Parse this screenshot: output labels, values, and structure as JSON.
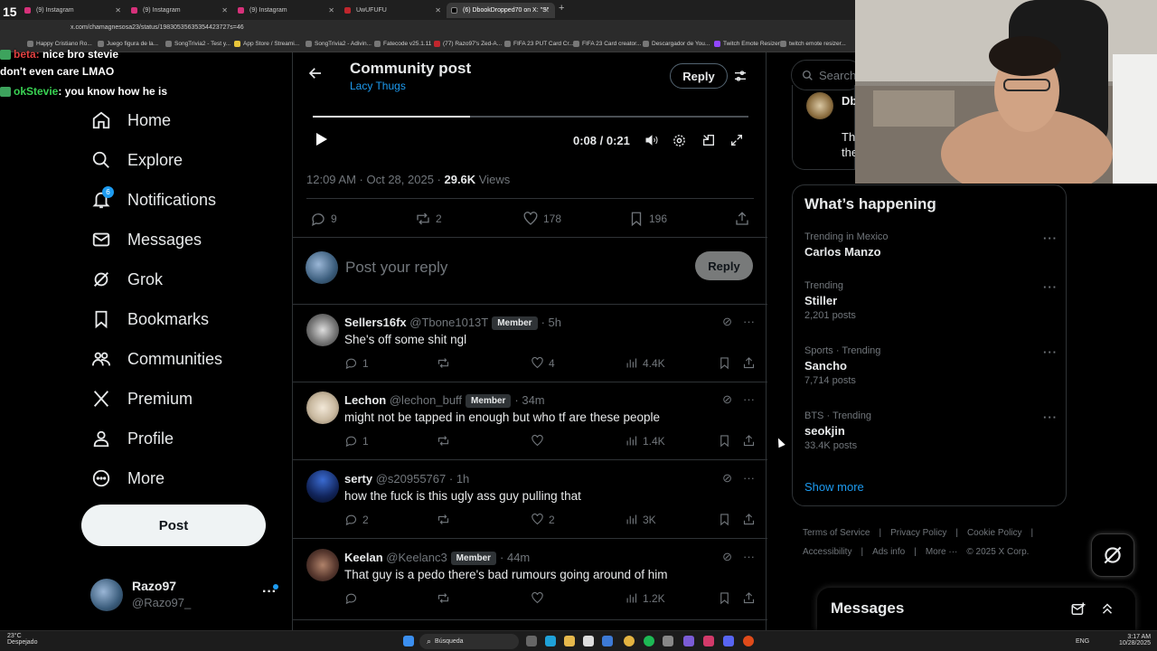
{
  "browser": {
    "tabs": [
      {
        "label": "(9) Instagram",
        "active": false
      },
      {
        "label": "(9) Instagram",
        "active": false
      },
      {
        "label": "(9) Instagram",
        "active": false
      },
      {
        "label": "UwUFUFU",
        "active": false
      },
      {
        "label": "(6) DbookDropped70 on X: \"S\"",
        "active": true
      }
    ],
    "url": "x.com/chamagnesosa23/status/19830535635354423727s=46",
    "bookmarks": [
      "Happy Cristiano Ro...",
      "Juego figura de la...",
      "SongTrivia2 - Test y...",
      "App Store / Streami...",
      "SongTrivia2 - Adivin...",
      "Fatecode v25.1.11",
      "(77) Razo97's Zed-A...",
      "FIFA 23 PUT Card Cr...",
      "FIFA 23 Card creator...",
      "Descargador de You...",
      "Twitch Emote Resizer",
      "twitch emote resizer..."
    ]
  },
  "overlay": {
    "counter": "15",
    "chat": [
      {
        "user": "beta:",
        "text": "nice bro stevie",
        "partial": true
      },
      {
        "user": "",
        "text": "don't even care LMAO"
      },
      {
        "user": "okStevie",
        "text": ": you know how he is"
      }
    ]
  },
  "nav": {
    "items": [
      {
        "label": "Home",
        "icon": "home-icon"
      },
      {
        "label": "Explore",
        "icon": "search-icon"
      },
      {
        "label": "Notifications",
        "icon": "bell-icon"
      },
      {
        "label": "Messages",
        "icon": "mail-icon"
      },
      {
        "label": "Grok",
        "icon": "grok-icon"
      },
      {
        "label": "Bookmarks",
        "icon": "bookmark-icon"
      },
      {
        "label": "Communities",
        "icon": "people-icon"
      },
      {
        "label": "Premium",
        "icon": "x-logo-icon"
      },
      {
        "label": "Profile",
        "icon": "person-icon"
      },
      {
        "label": "More",
        "icon": "more-circle-icon"
      }
    ],
    "notification_count": "6",
    "post_label": "Post",
    "account": {
      "name": "Razo97",
      "handle": "@Razo97_"
    }
  },
  "post": {
    "header_title": "Community post",
    "community": "Lacy Thugs",
    "reply_label": "Reply",
    "video_time": "0:08 / 0:21",
    "video_progress": 0.36,
    "meta_time": "12:09 AM · Oct 28, 2025 · ",
    "views_count": "29.6K",
    "views_label": " Views",
    "stats": {
      "replies": "9",
      "reposts": "2",
      "likes": "178",
      "bookmarks": "196"
    },
    "compose_placeholder": "Post your reply",
    "compose_button": "Reply"
  },
  "replies": [
    {
      "name": "Sellers16fx",
      "handle": "@Tbone1013T",
      "member": "Member",
      "time": "· 5h",
      "text": "She's off some shit ngl",
      "replies": "1",
      "reposts": "",
      "likes": "4",
      "views": "4.4K"
    },
    {
      "name": "Lechon",
      "handle": "@lechon_buff",
      "member": "Member",
      "time": "· 34m",
      "text": "might not be tapped in enough but who tf are these people",
      "replies": "1",
      "reposts": "",
      "likes": "",
      "views": "1.4K"
    },
    {
      "name": "serty",
      "handle": "@s20955767",
      "member": "",
      "time": "· 1h",
      "text": "how the fuck is this ugly ass guy pulling that",
      "replies": "2",
      "reposts": "",
      "likes": "2",
      "views": "3K"
    },
    {
      "name": "Keelan",
      "handle": "@Keelanc3",
      "member": "Member",
      "time": "· 44m",
      "text": "That guy is a pedo there's bad rumours going around of him",
      "replies": "",
      "reposts": "",
      "likes": "",
      "views": "1.2K"
    }
  ],
  "right": {
    "search_placeholder": "Search",
    "partial_name": "Db",
    "partial_text": [
      "Th",
      "the"
    ],
    "happening_title": "What’s happening",
    "trends": [
      {
        "context": "Trending in Mexico",
        "name": "Carlos Manzo",
        "count": ""
      },
      {
        "context": "Trending",
        "name": "Stiller",
        "count": "2,201 posts"
      },
      {
        "context": "Sports · Trending",
        "name": "Sancho",
        "count": "7,714 posts"
      },
      {
        "context": "BTS · Trending",
        "name": "seokjin",
        "count": "33.4K posts"
      }
    ],
    "show_more": "Show more",
    "footer": [
      "Terms of Service",
      "|",
      "Privacy Policy",
      "|",
      "Cookie Policy",
      "|",
      "Accessibility",
      "|",
      "Ads info",
      "|",
      "More ···",
      "© 2025 X Corp."
    ],
    "messages_title": "Messages"
  },
  "taskbar": {
    "weather_temp": "23°C",
    "weather_desc": "Despejado",
    "search": "Búsqueda",
    "lang": "ENG",
    "time": "3:17 AM",
    "date": "10/28/2025"
  }
}
